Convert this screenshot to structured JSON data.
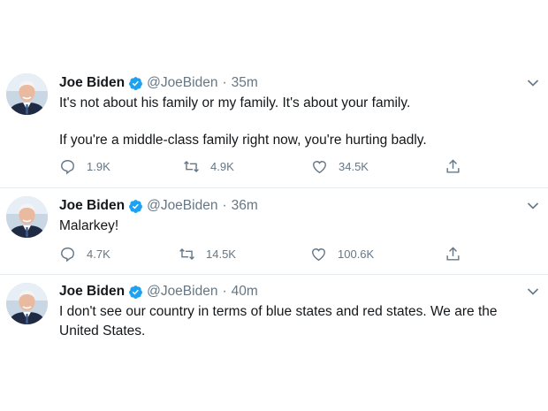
{
  "tweets": [
    {
      "name": "Joe Biden",
      "handle": "@JoeBiden",
      "dot": "·",
      "time": "35m",
      "paragraphs": [
        "It's not about his family or my family. It's about your family.",
        "If you're a middle-class family right now, you're hurting badly."
      ],
      "replies": "1.9K",
      "retweets": "4.9K",
      "likes": "34.5K"
    },
    {
      "name": "Joe Biden",
      "handle": "@JoeBiden",
      "dot": "·",
      "time": "36m",
      "paragraphs": [
        "Malarkey!"
      ],
      "replies": "4.7K",
      "retweets": "14.5K",
      "likes": "100.6K"
    },
    {
      "name": "Joe Biden",
      "handle": "@JoeBiden",
      "dot": "·",
      "time": "40m",
      "paragraphs": [
        "I don't see our country in terms of blue states and red states. We are the United States."
      ]
    }
  ],
  "icons": {
    "verified": "verified-badge-icon",
    "reply": "reply-icon",
    "retweet": "retweet-icon",
    "like": "heart-icon",
    "share": "share-icon",
    "more": "chevron-down-icon"
  },
  "colors": {
    "verified": "#1da1f2",
    "secondary": "#657786",
    "divider": "#e6ecf0"
  }
}
